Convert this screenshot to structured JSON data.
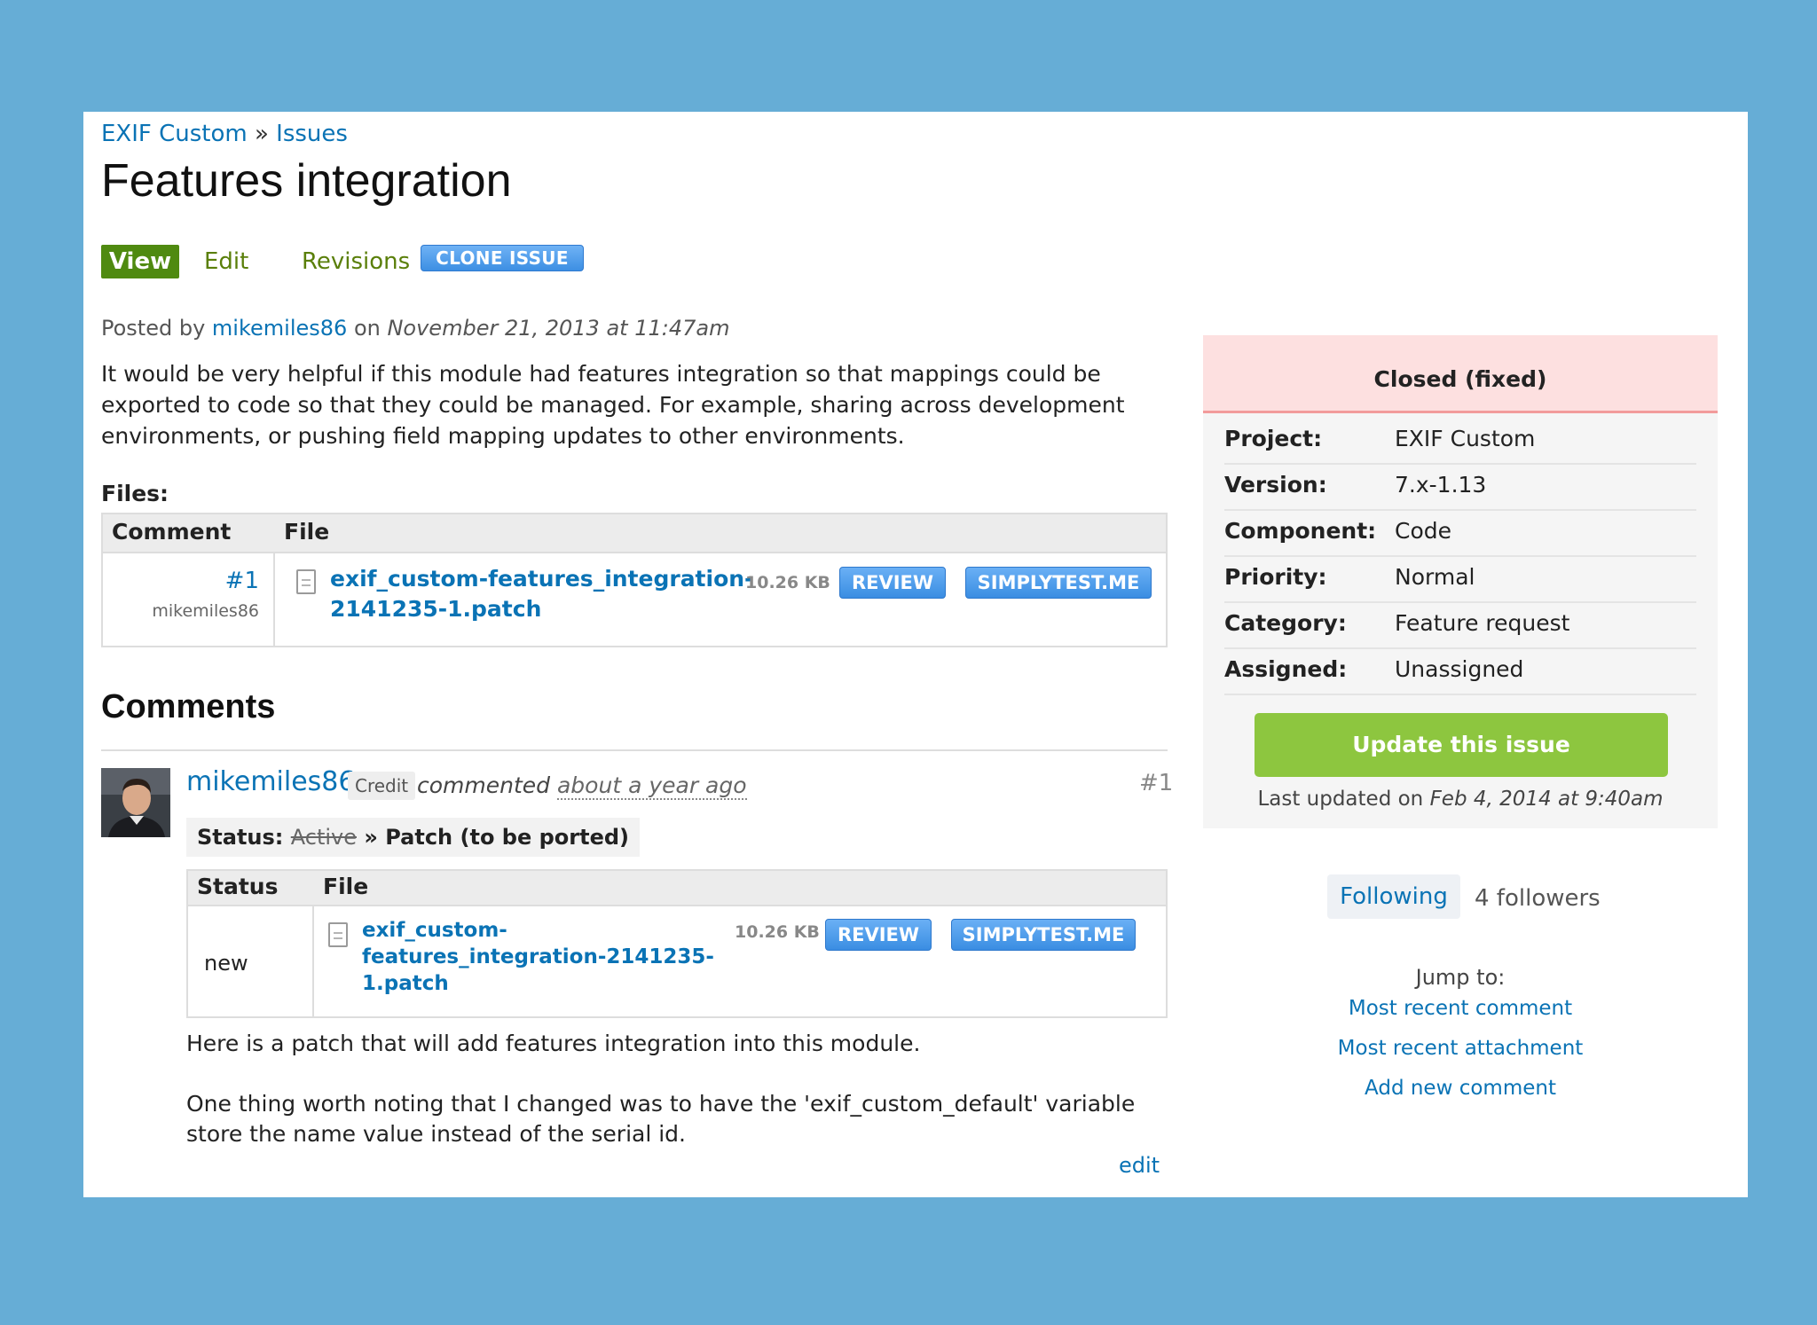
{
  "breadcrumb": {
    "project": "EXIF Custom",
    "separator": " » ",
    "section": "Issues"
  },
  "page_title": "Features integration",
  "tabs": [
    {
      "label": "View",
      "active": true
    },
    {
      "label": "Edit"
    },
    {
      "label": "Revisions"
    }
  ],
  "clone_button": "CLONE ISSUE",
  "post": {
    "posted_by_prefix": "Posted by ",
    "author": "mikemiles86",
    "on": " on ",
    "date": "November 21, 2013 at 11:47am",
    "body": "It would be very helpful if this module had features integration so that mappings could be exported to code so that they could be managed. For example, sharing across development environments, or pushing field mapping updates to other environments."
  },
  "files": {
    "label": "Files:",
    "columns": [
      "Comment",
      "File"
    ],
    "rows": [
      {
        "comment_ref": "#1",
        "comment_author": "mikemiles86",
        "file_name": "exif_custom-features_integration-2141235-1.patch",
        "file_line1": "exif_custom-features_integration-",
        "file_line2": "2141235-1.patch",
        "size": "10.26 KB",
        "review": "REVIEW",
        "simplytest": "SIMPLYTEST.ME"
      }
    ]
  },
  "comments": {
    "heading": "Comments",
    "items": [
      {
        "author": "mikemiles86",
        "credit": "Credit",
        "commented": "commented ",
        "time": "about a year ago",
        "number": "#1",
        "status_label": "Status: ",
        "status_old": "Active",
        "status_arrow": " » ",
        "status_new": "Patch (to be ported)",
        "table": {
          "columns": [
            "Status",
            "File"
          ],
          "status": "new",
          "file_line1": "exif_custom-",
          "file_line2": "features_integration-2141235-",
          "file_line3": "1.patch",
          "size": "10.26 KB",
          "review": "REVIEW",
          "simplytest": "SIMPLYTEST.ME"
        },
        "body1": "Here is a patch that will add features integration into this module.",
        "body2": "One thing worth noting that I changed was to have the 'exif_custom_default' variable store the name value instead of the serial id.",
        "edit": "edit"
      }
    ]
  },
  "sidebar": {
    "status": "Closed (fixed)",
    "meta": [
      {
        "label": "Project:",
        "value": "EXIF Custom"
      },
      {
        "label": "Version:",
        "value": "7.x-1.13"
      },
      {
        "label": "Component:",
        "value": "Code"
      },
      {
        "label": "Priority:",
        "value": "Normal"
      },
      {
        "label": "Category:",
        "value": "Feature request"
      },
      {
        "label": "Assigned:",
        "value": "Unassigned"
      }
    ],
    "update_button": "Update this issue",
    "last_updated_prefix": "Last updated on ",
    "last_updated": "Feb 4, 2014 at 9:40am",
    "following": "Following",
    "followers": "4 followers",
    "jump_to": "Jump to:",
    "jump_links": [
      "Most recent comment",
      "Most recent attachment",
      "Add new comment"
    ]
  },
  "colors": {
    "page_background": "#66add6",
    "link": "#0a73b5",
    "active_tab": "#4f8a10",
    "status_closed_bg": "#fde0e0",
    "update_button": "#8dc63f"
  }
}
